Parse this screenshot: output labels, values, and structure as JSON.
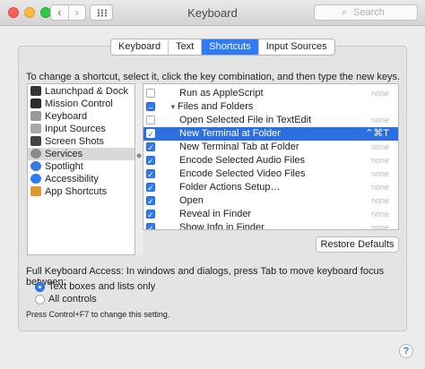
{
  "window": {
    "title": "Keyboard",
    "search_placeholder": "Search",
    "nav_back": "‹",
    "nav_forward": "›"
  },
  "tabs": [
    {
      "label": "Keyboard",
      "active": false
    },
    {
      "label": "Text",
      "active": false
    },
    {
      "label": "Shortcuts",
      "active": true
    },
    {
      "label": "Input Sources",
      "active": false
    }
  ],
  "instructions": "To change a shortcut, select it, click the key combination, and then type the new keys.",
  "categories": [
    {
      "label": "Launchpad & Dock",
      "icon": "launchpad-icon",
      "color": "#333333"
    },
    {
      "label": "Mission Control",
      "icon": "mission-control-icon",
      "color": "#2a2a2a"
    },
    {
      "label": "Keyboard",
      "icon": "keyboard-icon",
      "color": "#9a9a9a"
    },
    {
      "label": "Input Sources",
      "icon": "input-sources-icon",
      "color": "#a8a8a8"
    },
    {
      "label": "Screen Shots",
      "icon": "screenshot-icon",
      "color": "#444444"
    },
    {
      "label": "Services",
      "icon": "gear-icon",
      "color": "#8a8a8a",
      "selected": true
    },
    {
      "label": "Spotlight",
      "icon": "spotlight-icon",
      "color": "#3a7bd5"
    },
    {
      "label": "Accessibility",
      "icon": "accessibility-icon",
      "color": "#2f7bf6"
    },
    {
      "label": "App Shortcuts",
      "icon": "app-shortcuts-icon",
      "color": "#d99a2b"
    }
  ],
  "shortcuts": [
    {
      "label": "Run as AppleScript",
      "checked": "off",
      "key": "none",
      "indent": 2
    },
    {
      "label": "Files and Folders",
      "checked": "mixed",
      "key": "",
      "indent": 1,
      "group": true
    },
    {
      "label": "Open Selected File in TextEdit",
      "checked": "off",
      "key": "none",
      "indent": 2
    },
    {
      "label": "New Terminal at Folder",
      "checked": "on",
      "key": "⌃⌘T",
      "indent": 2,
      "selected": true
    },
    {
      "label": "New Terminal Tab at Folder",
      "checked": "on",
      "key": "none",
      "indent": 2
    },
    {
      "label": "Encode Selected Audio Files",
      "checked": "on",
      "key": "none",
      "indent": 2
    },
    {
      "label": "Encode Selected Video Files",
      "checked": "on",
      "key": "none",
      "indent": 2
    },
    {
      "label": "Folder Actions Setup…",
      "checked": "on",
      "key": "none",
      "indent": 2
    },
    {
      "label": "Open",
      "checked": "on",
      "key": "none",
      "indent": 2
    },
    {
      "label": "Reveal in Finder",
      "checked": "on",
      "key": "none",
      "indent": 2
    },
    {
      "label": "Show Info in Finder",
      "checked": "on",
      "key": "none",
      "indent": 2
    }
  ],
  "restore_label": "Restore Defaults",
  "full_keyboard_access": {
    "label": "Full Keyboard Access: In windows and dialogs, press Tab to move keyboard focus between:",
    "options": [
      {
        "label": "Text boxes and lists only",
        "selected": true
      },
      {
        "label": "All controls",
        "selected": false
      }
    ],
    "hint": "Press Control+F7 to change this setting."
  },
  "help_label": "?"
}
